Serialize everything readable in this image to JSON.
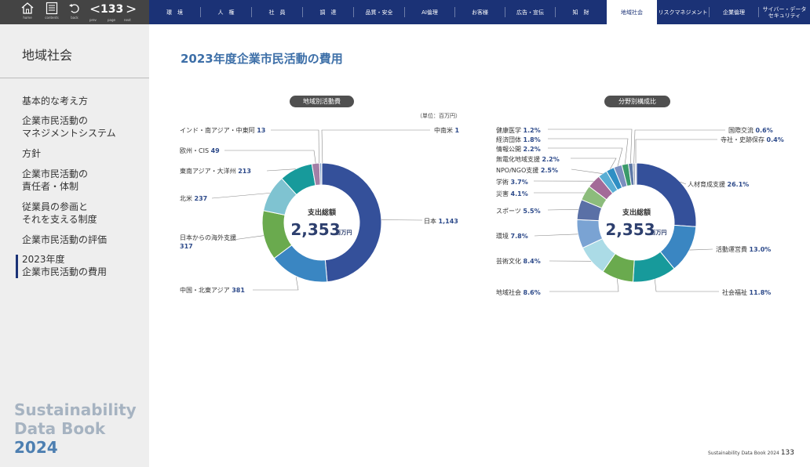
{
  "nav": {
    "home": "home",
    "contents": "contents",
    "back": "back",
    "prev": "prev",
    "page_caption": "page",
    "next": "next",
    "page_number": "133",
    "arrow_prev": "<",
    "arrow_next": ">",
    "tabs": [
      "環　境",
      "人　権",
      "社　員",
      "調　達",
      "品質・安全",
      "AI倫理",
      "お客様",
      "広告・宣伝",
      "知　財",
      "地域社会",
      "リスクマネジメント",
      "企業倫理",
      "サイバー・データ\nセキュリティ"
    ],
    "active_tab": "地域社会"
  },
  "sidebar": {
    "title": "地域社会",
    "items": [
      "基本的な考え方",
      "企業市民活動の\nマネジメントシステム",
      "方針",
      "企業市民活動の\n責任者・体制",
      "従業員の参画と\nそれを支える制度",
      "企業市民活動の評価",
      "2023年度\n企業市民活動の費用"
    ],
    "brand_line1": "Sustainability",
    "brand_line2": "Data Book",
    "brand_year": "2024"
  },
  "main": {
    "title": "2023年度企業市民活動の費用",
    "unit_note": "（単位：百万円）",
    "footer_text": "Sustainability Data Book 2024",
    "footer_page": "133"
  },
  "colors": {
    "nav": "#1b3276",
    "title": "#3d6fa8",
    "value": "#2d4a8a"
  },
  "chart_data": [
    {
      "type": "pie",
      "title": "地域別活動費",
      "center_label": "支出総額",
      "center_value": "2,353",
      "center_unit": "百万円",
      "unit": "百万円",
      "labels": [
        "日本",
        "中国・北東アジア",
        "日本からの海外支援",
        "北米",
        "東南アジア・大洋州",
        "欧州・CIS",
        "インド・南アジア・中東阿",
        "中南米"
      ],
      "values": [
        1143,
        381,
        317,
        237,
        213,
        49,
        13,
        1
      ],
      "value_labels": [
        "1,143",
        "381",
        "317",
        "237",
        "213",
        "49",
        "13",
        "1"
      ],
      "colors": [
        "#34509a",
        "#3a86c2",
        "#6aaa4e",
        "#7fc3d1",
        "#179a9b",
        "#a37fa6",
        "#7f9fc9",
        "#3a9a73"
      ]
    },
    {
      "type": "pie",
      "title": "分野別構成比",
      "center_label": "支出総額",
      "center_value": "2,353",
      "center_unit": "百万円",
      "unit": "%",
      "labels": [
        "人材育成支援",
        "活動運営費",
        "社会福祉",
        "地域社会",
        "芸術文化",
        "環境",
        "スポーツ",
        "災害",
        "学術",
        "NPO/NGO支援",
        "無電化地域支援",
        "情報公開",
        "経済団体",
        "健康医学",
        "国際交流",
        "寺社・史跡保存"
      ],
      "values": [
        26.1,
        13.0,
        11.8,
        8.6,
        8.4,
        7.8,
        5.5,
        4.1,
        3.7,
        2.5,
        2.2,
        2.2,
        1.8,
        1.2,
        0.6,
        0.4
      ],
      "value_labels": [
        "26.1%",
        "13.0%",
        "11.8%",
        "8.6%",
        "8.4%",
        "7.8%",
        "5.5%",
        "4.1%",
        "3.7%",
        "2.5%",
        "2.2%",
        "2.2%",
        "1.8%",
        "1.2%",
        "0.6%",
        "0.4%"
      ],
      "colors": [
        "#34509a",
        "#3a86c2",
        "#179a9b",
        "#6aaa4e",
        "#abdbe6",
        "#7aa3d3",
        "#5a70a6",
        "#8cbc7c",
        "#a36b98",
        "#5aaed4",
        "#2f8fc4",
        "#7b8fc0",
        "#3a9a6a",
        "#5f7aa8",
        "#95a0b5",
        "#c4c9d2"
      ]
    }
  ]
}
